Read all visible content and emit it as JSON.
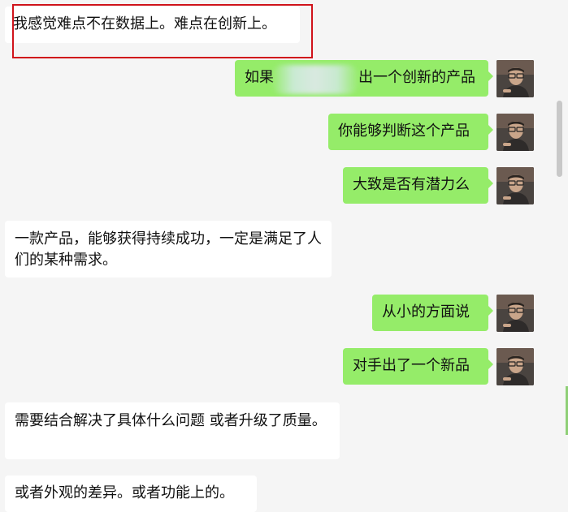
{
  "messages": [
    {
      "side": "incoming",
      "text": "我感觉难点不在数据上。难点在创新上。"
    },
    {
      "side": "outgoing",
      "text_before": "如果",
      "text_after": "出一个创新的产品"
    },
    {
      "side": "outgoing",
      "text": "你能够判断这个产品"
    },
    {
      "side": "outgoing",
      "text": "大致是否有潜力么"
    },
    {
      "side": "incoming",
      "text": "一款产品，能够获得持续成功，一定是满足了人们的某种需求。"
    },
    {
      "side": "outgoing",
      "text": "从小的方面说"
    },
    {
      "side": "outgoing",
      "text": "对手出了一个新品"
    },
    {
      "side": "incoming",
      "text": "需要结合解决了具体什么问题  或者升级了质量。"
    },
    {
      "side": "incoming",
      "text": "或者外观的差异。或者功能上的。"
    }
  ],
  "colors": {
    "outgoing_bubble": "#95ec69",
    "incoming_bubble": "#ffffff",
    "background": "#f5f5f5",
    "highlight_border": "#d0131b"
  },
  "avatar_icon": "user-avatar-photo"
}
